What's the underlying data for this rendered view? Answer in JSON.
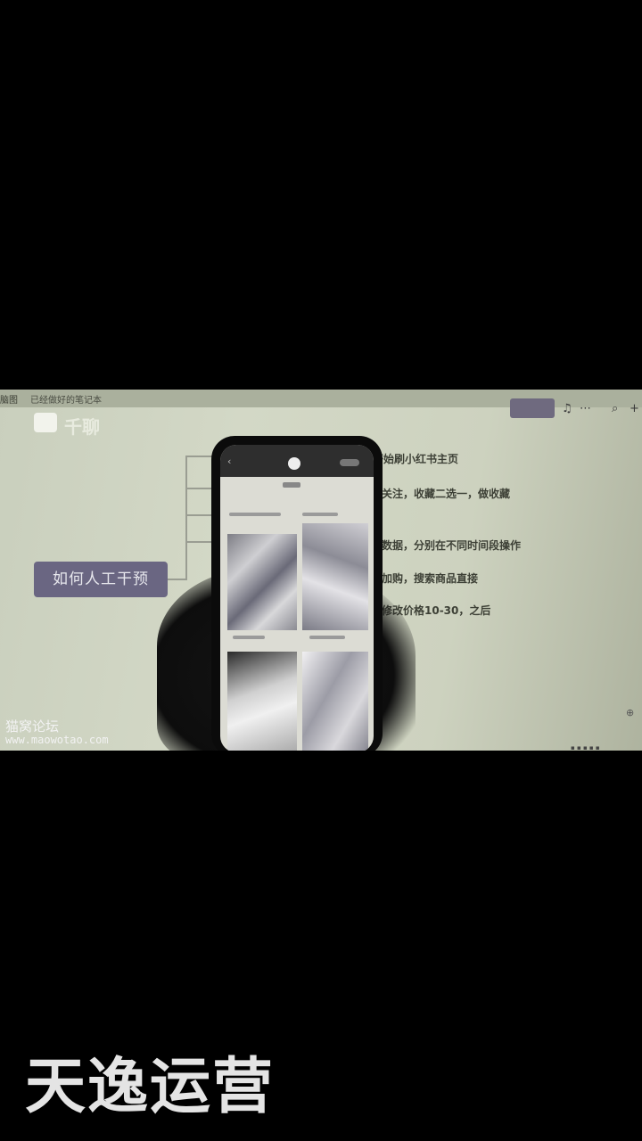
{
  "monitor": {
    "top_left_text": "脑图",
    "doc_title": "已经做好的笔记本",
    "app_name": "千聊"
  },
  "mindmap": {
    "central_node": "如何人工干预",
    "branches": [
      "开始刷小红书主页",
      "关注，收藏二选一，做收藏",
      "数据，分别在不同时间段操作",
      "加购，搜索商品直接",
      "修改价格10-30，之后"
    ]
  },
  "watermark": {
    "site_name": "猫窝论坛",
    "url": "www.maowotao.com"
  },
  "caption": "天逸运营"
}
